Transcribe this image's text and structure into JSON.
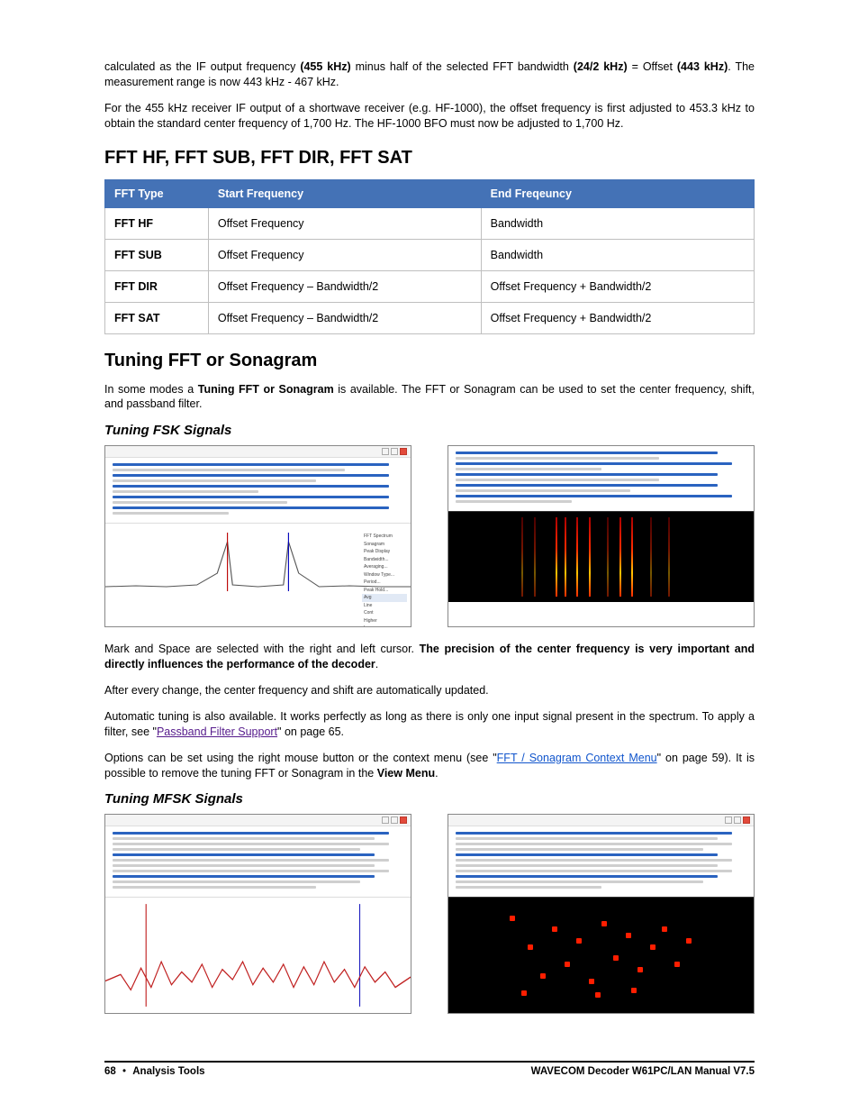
{
  "intro": {
    "p1_pre": "calculated as the IF output frequency ",
    "p1_b1": "(455 kHz)",
    "p1_mid": " minus half of the selected FFT bandwidth ",
    "p1_b2": "(24/2 kHz)",
    "p1_post": " = Offset ",
    "p1_b3": "(443 kHz)",
    "p1_tail": ". The measurement range is now 443 kHz - 467 kHz.",
    "p2": "For the 455 kHz receiver IF output of a shortwave receiver (e.g. HF-1000), the offset frequency is first adjusted to 453.3 kHz to obtain the standard center frequency of 1,700 Hz. The HF-1000 BFO must now be adjusted to 1,700 Hz."
  },
  "section1_title": "FFT HF, FFT SUB, FFT DIR, FFT SAT",
  "table": {
    "headers": [
      "FFT Type",
      "Start Frequency",
      "End Freqeuncy"
    ],
    "rows": [
      [
        "FFT HF",
        "Offset Frequency",
        "Bandwidth"
      ],
      [
        "FFT SUB",
        "Offset Frequency",
        "Bandwidth"
      ],
      [
        "FFT DIR",
        "Offset Frequency – Bandwidth/2",
        "Offset Frequency + Bandwidth/2"
      ],
      [
        "FFT SAT",
        "Offset Frequency – Bandwidth/2",
        "Offset Frequency + Bandwidth/2"
      ]
    ]
  },
  "section2_title": "Tuning FFT or Sonagram",
  "section2": {
    "p1_pre": "In some modes a ",
    "p1_bold": "Tuning FFT or Sonagram",
    "p1_post": " is available. The FFT or Sonagram can be used to set the center frequency, shift, and passband filter."
  },
  "sub_fsk_title": "Tuning FSK Signals",
  "fsk": {
    "p1_pre": "Mark and Space are selected with the right and left cursor. ",
    "p1_bold": "The precision of the center frequency is very important and directly influences the performance of the decoder",
    "p1_post": ".",
    "p2": "After every change, the center frequency and shift are automatically updated.",
    "p3_pre": "Automatic tuning is also available. It works perfectly as long as there is only one input signal present in the spectrum. To apply a filter, see \"",
    "p3_link": "Passband Filter Support",
    "p3_post": "\" on page 65.",
    "p4_pre": "Options can be set using the right mouse button or the context menu (see \"",
    "p4_link": "FFT / Sonagram Context Menu",
    "p4_mid": "\" on page 59). It is possible to remove the tuning FFT or Sonagram in the ",
    "p4_bold": "View Menu",
    "p4_post": "."
  },
  "sub_mfsk_title": "Tuning MFSK Signals",
  "footer": {
    "page": "68",
    "section": "Analysis Tools",
    "product": "WAVECOM Decoder W61PC/LAN Manual V7.5"
  }
}
